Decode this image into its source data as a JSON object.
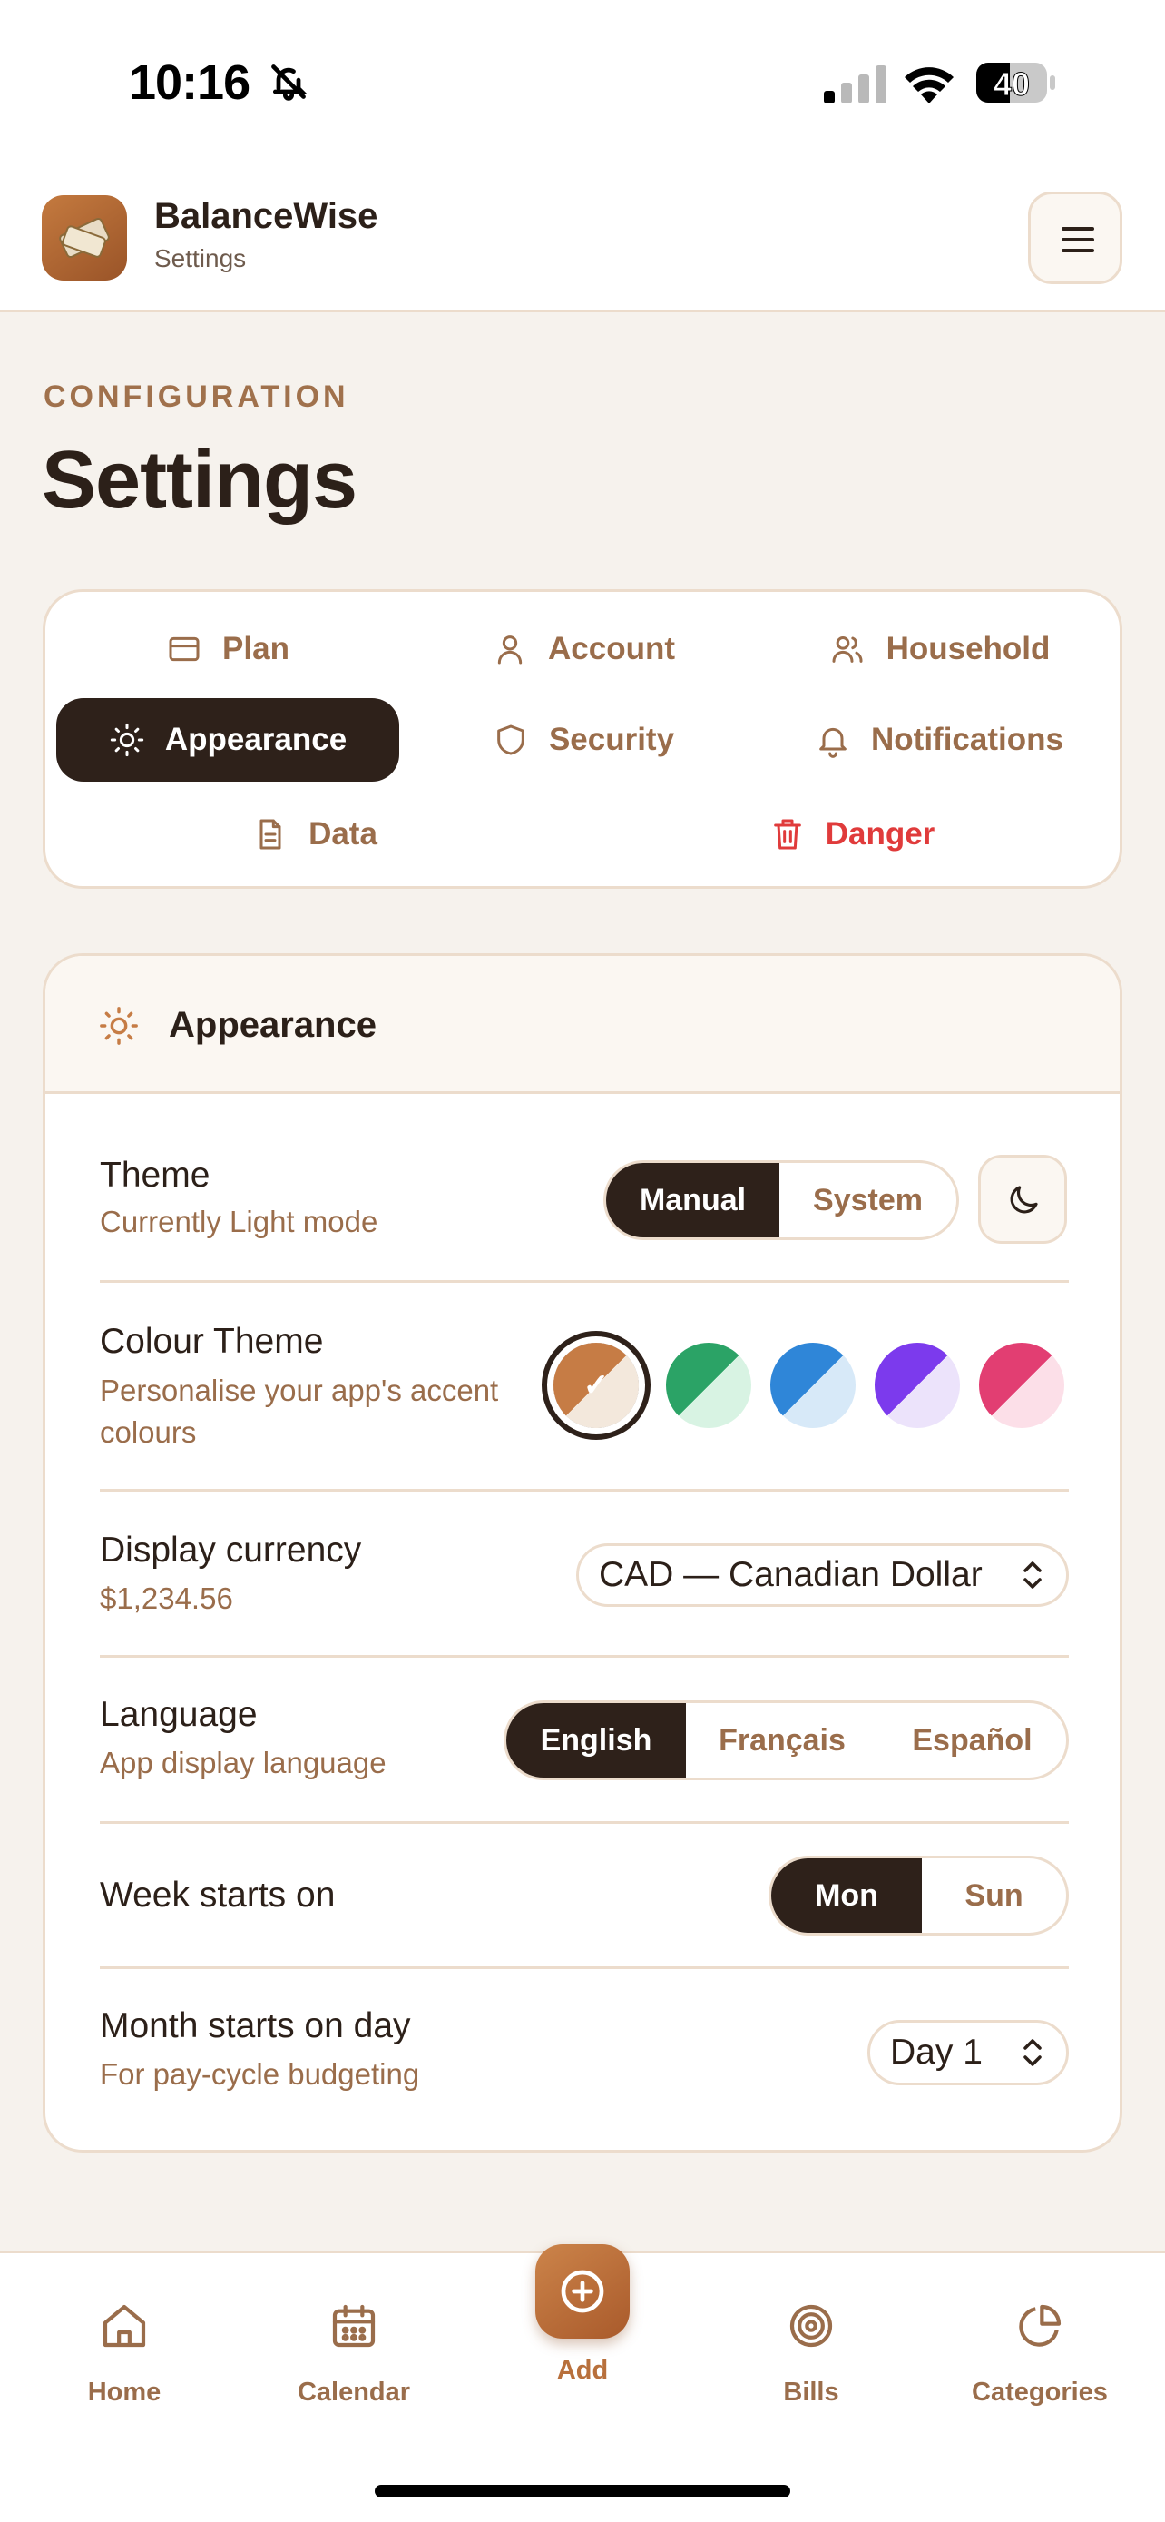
{
  "status_bar": {
    "time": "10:16",
    "battery": "40"
  },
  "app": {
    "name": "BalanceWise",
    "subtitle": "Settings"
  },
  "page": {
    "eyebrow": "CONFIGURATION",
    "title": "Settings"
  },
  "tabs": [
    {
      "label": "Plan",
      "icon": "card-icon"
    },
    {
      "label": "Account",
      "icon": "user-icon"
    },
    {
      "label": "Household",
      "icon": "users-icon"
    },
    {
      "label": "Appearance",
      "icon": "sun-icon",
      "active": true
    },
    {
      "label": "Security",
      "icon": "shield-icon"
    },
    {
      "label": "Notifications",
      "icon": "bell-icon"
    },
    {
      "label": "Data",
      "icon": "document-icon"
    },
    {
      "label": "Danger",
      "icon": "trash-icon",
      "color": "#e03b3b"
    }
  ],
  "appearance": {
    "title": "Appearance",
    "theme": {
      "label": "Theme",
      "sub": "Currently Light mode",
      "options": [
        "Manual",
        "System"
      ],
      "selected": "Manual"
    },
    "colour_theme": {
      "label": "Colour Theme",
      "sub": "Personalise your app's accent colours",
      "swatches": [
        {
          "name": "copper",
          "accent": "#c67c45",
          "tint": "#f3e8dc",
          "selected": true
        },
        {
          "name": "green",
          "accent": "#2ba366",
          "tint": "#d8f3e3"
        },
        {
          "name": "blue",
          "accent": "#2f86d8",
          "tint": "#d7e9f8"
        },
        {
          "name": "purple",
          "accent": "#7c3aed",
          "tint": "#ece3fb"
        },
        {
          "name": "pink",
          "accent": "#e23e72",
          "tint": "#fcdfe8"
        }
      ]
    },
    "currency": {
      "label": "Display currency",
      "sample": "$1,234.56",
      "value": "CAD — Canadian Dollar"
    },
    "language": {
      "label": "Language",
      "sub": "App display language",
      "options": [
        "English",
        "Français",
        "Español"
      ],
      "selected": "English"
    },
    "week": {
      "label": "Week starts on",
      "options": [
        "Mon",
        "Sun"
      ],
      "selected": "Mon"
    },
    "month": {
      "label": "Month starts on day",
      "sub": "For pay-cycle budgeting",
      "value": "Day 1"
    }
  },
  "bottom_nav": {
    "home": "Home",
    "calendar": "Calendar",
    "add": "Add",
    "bills": "Bills",
    "categories": "Categories"
  },
  "colors": {
    "accent": "#c67c45",
    "dark": "#2e211a",
    "muted": "#9a6d4b",
    "border": "#ecdccc",
    "danger": "#e03b3b",
    "background": "#f6f2ed"
  }
}
